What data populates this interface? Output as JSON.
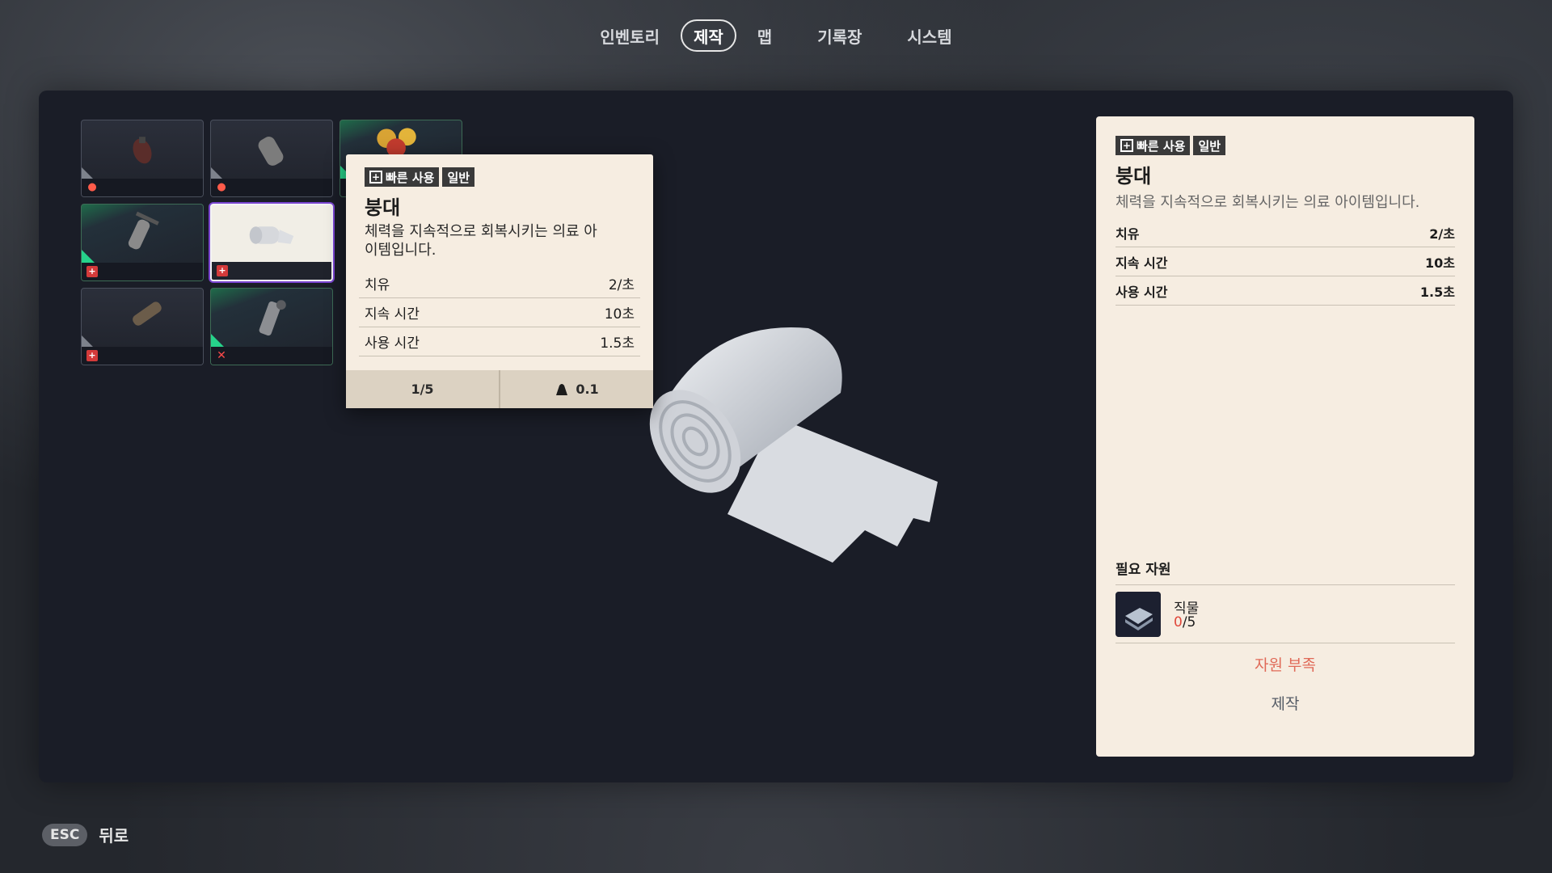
{
  "nav": {
    "tabs": [
      {
        "label": "인벤토리"
      },
      {
        "label": "제작"
      },
      {
        "label": "맵"
      },
      {
        "label": "기록장"
      },
      {
        "label": "시스템"
      }
    ],
    "active_tab": "제작"
  },
  "tooltip": {
    "tag_quick": "빠른 사용",
    "tag_rarity": "일반",
    "name": "붕대",
    "description": "체력을 지속적으로 회복시키는 의료 아이템입니다.",
    "stats": [
      {
        "label": "치유",
        "value": "2/초"
      },
      {
        "label": "지속 시간",
        "value": "10초"
      },
      {
        "label": "사용 시간",
        "value": "1.5초"
      }
    ],
    "stack": "1/5",
    "weight": "0.1"
  },
  "detail": {
    "tag_quick": "빠른 사용",
    "tag_rarity": "일반",
    "name": "붕대",
    "description": "체력을 지속적으로 회복시키는 의료 아이템입니다.",
    "stats": [
      {
        "label": "치유",
        "value": "2/초"
      },
      {
        "label": "지속 시간",
        "value": "10초"
      },
      {
        "label": "사용 시간",
        "value": "1.5초"
      }
    ],
    "required_title": "필요 자원",
    "required": {
      "name": "직물",
      "have": "0",
      "need": "/5"
    },
    "lack_text": "자원 부족",
    "craft_label": "제작"
  },
  "footer": {
    "esc_key": "ESC",
    "back_label": "뒤로"
  },
  "colors": {
    "panel_bg": "#f6ede1",
    "accent_green": "#26d38a",
    "warning_red": "#e06a58",
    "selected_outline": "#7a45d1"
  }
}
